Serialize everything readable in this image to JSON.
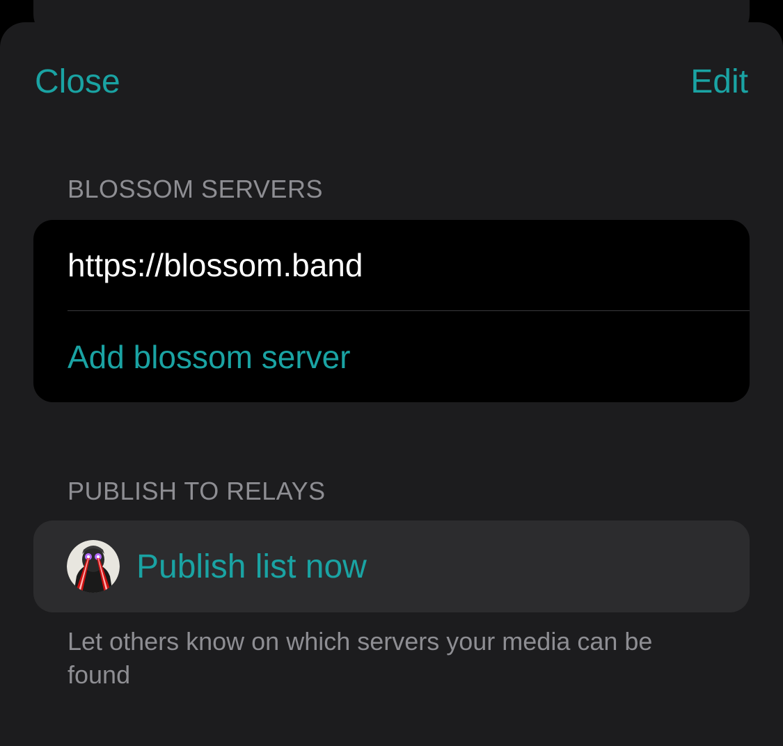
{
  "nav": {
    "close_label": "Close",
    "edit_label": "Edit"
  },
  "blossom_servers": {
    "header": "BLOSSOM SERVERS",
    "servers": [
      "https://blossom.band"
    ],
    "add_label": "Add blossom server"
  },
  "publish": {
    "header": "PUBLISH TO RELAYS",
    "button_label": "Publish list now",
    "avatar_icon": "user-avatar-icon",
    "footer": "Let others know on which servers your media can be found"
  },
  "colors": {
    "accent": "#1aa3a3",
    "background": "#1c1c1e",
    "card_dark": "#000000",
    "card_gray": "#2c2c2e",
    "secondary_text": "#8e8e93"
  }
}
